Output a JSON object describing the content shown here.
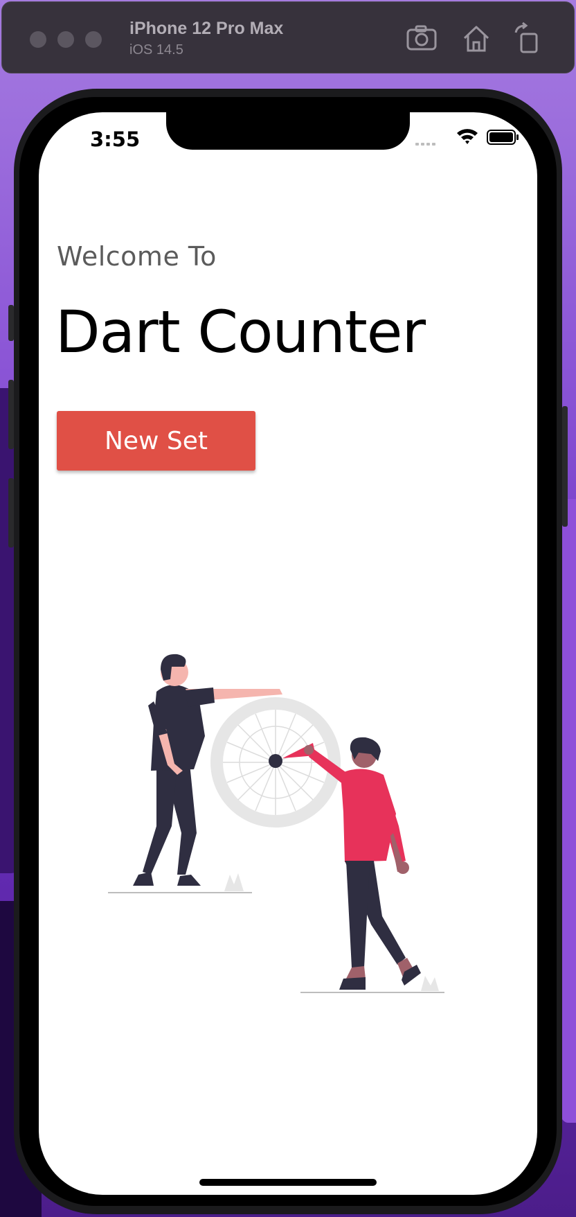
{
  "simulator": {
    "device_name": "iPhone 12 Pro Max",
    "os_version": "iOS 14.5",
    "buttons": [
      "screenshot-icon",
      "home-icon",
      "rotate-icon"
    ]
  },
  "status_bar": {
    "time": "3:55"
  },
  "main": {
    "welcome_text": "Welcome To",
    "title": "Dart Counter",
    "new_set_label": "New Set"
  },
  "colors": {
    "accent": "#e05046",
    "shirt": "#e7325a",
    "dark": "#2f2e41",
    "skin_light": "#f5b5ae",
    "skin_dark": "#a0616a",
    "board": "#e6e6e6"
  }
}
